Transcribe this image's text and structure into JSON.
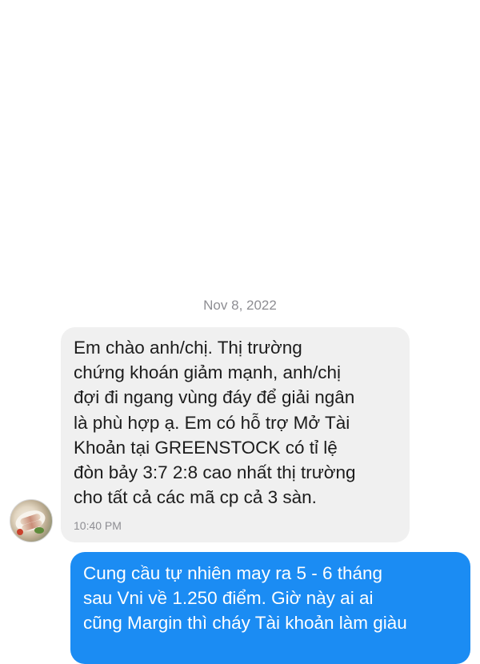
{
  "conversation": {
    "date_divider": "Nov 8, 2022",
    "incoming": {
      "avatar_icon": "food-photo-avatar",
      "text": "Em chào anh/chị. Thị trường\nchứng khoán giảm mạnh, anh/chị\nđợi đi ngang vùng đáy để giải ngân\nlà phù hợp ạ. Em có hỗ trợ Mở Tài\nKhoản tại GREENSTOCK có tỉ lệ\nđòn bảy 3:7 2:8 cao nhất thị trường\ncho tất cả các mã cp cả 3 sàn.",
      "time": "10:40 PM",
      "bubble_color": "#f0f0f0"
    },
    "outgoing": {
      "text": "Cung cầu tự nhiên may ra 5 - 6 tháng\nsau Vni về 1.250 điểm. Giờ này ai ai\ncũng Margin thì cháy Tài khoản làm giàu",
      "bubble_color": "#1b8cf3"
    }
  }
}
